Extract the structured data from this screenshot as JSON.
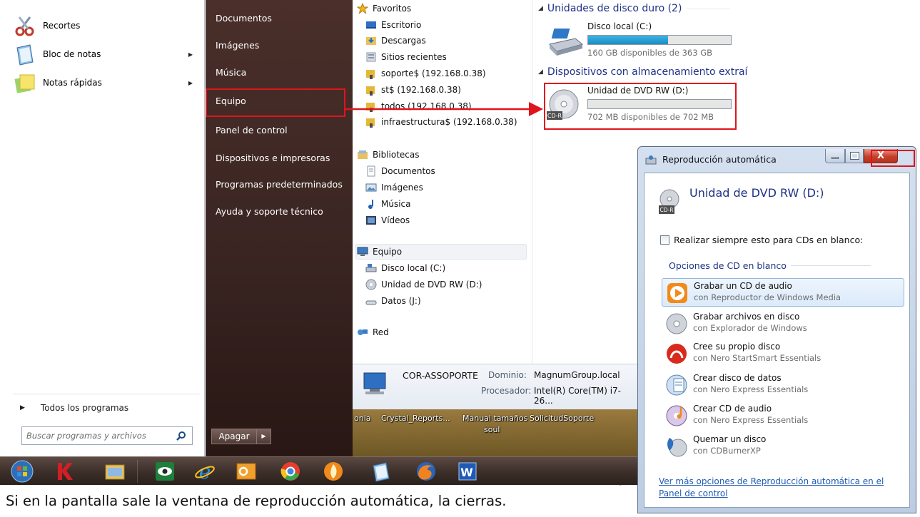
{
  "start_menu": {
    "programs": [
      {
        "label": "Recortes",
        "icon": "scissors-icon",
        "submenu": false
      },
      {
        "label": "Bloc de notas",
        "icon": "notepad-icon",
        "submenu": true
      },
      {
        "label": "Notas rápidas",
        "icon": "sticky-notes-icon",
        "submenu": true
      }
    ],
    "all_programs": "Todos los programas",
    "search_placeholder": "Buscar programas y archivos",
    "places": [
      "Documentos",
      "Imágenes",
      "Música",
      "Equipo",
      "Panel de control",
      "Dispositivos e impresoras",
      "Programas predeterminados",
      "Ayuda y soporte técnico"
    ],
    "shutdown_label": "Apagar"
  },
  "explorer": {
    "nav": {
      "favorites": "Favoritos",
      "favorite_items": [
        "Escritorio",
        "Descargas",
        "Sitios recientes",
        "soporte$ (192.168.0.38)",
        "st$ (192.168.0.38)",
        "todos (192.168.0.38)",
        "infraestructura$ (192.168.0.38)"
      ],
      "libraries": "Bibliotecas",
      "library_items": [
        "Documentos",
        "Imágenes",
        "Música",
        "Vídeos"
      ],
      "computer": "Equipo",
      "computer_items": [
        "Disco local (C:)",
        "Unidad de DVD RW (D:)",
        "Datos (J:)"
      ],
      "network": "Red"
    },
    "groups": {
      "hard_disks": "Unidades de disco duro (2)",
      "removable": "Dispositivos con almacenamiento extraí"
    },
    "drives": [
      {
        "name": "Disco local (C:)",
        "free": "160 GB disponibles de 363 GB",
        "used_fraction": 0.56
      },
      {
        "name": "Unidad de DVD RW (D:)",
        "free": "702 MB disponibles de 702 MB",
        "used_fraction": 0.0
      }
    ],
    "details": {
      "computer_name": "COR-ASSOPORTE",
      "domain_label": "Dominio:",
      "domain_value": "MagnumGroup.local",
      "cpu_label": "Procesador:",
      "cpu_value": "Intel(R) Core(TM) i7-26..."
    }
  },
  "desktop_labels": [
    "onia",
    "Crystal_Reports...",
    "Manual tamaños",
    "SolicitudSoporte",
    "soul"
  ],
  "taskbar": {
    "icons": [
      "start-orb-icon",
      "kaspersky-icon",
      "file-explorer-icon",
      "eye-app-icon",
      "internet-explorer-icon",
      "outlook-icon",
      "chrome-icon",
      "app-flame-icon",
      "notepad-icon",
      "firefox-icon",
      "word-icon"
    ]
  },
  "autoplay": {
    "title": "Reproducción automática",
    "device": "Unidad de DVD RW (D:)",
    "always_do": "Realizar siempre esto para CDs en blanco:",
    "options_header": "Opciones de CD en blanco",
    "options": [
      {
        "label": "Grabar un CD de audio",
        "sub": "con Reproductor de Windows Media",
        "icon": "media-player-icon"
      },
      {
        "label": "Grabar archivos en disco",
        "sub": "con Explorador de Windows",
        "icon": "disc-icon"
      },
      {
        "label": "Cree su propio disco",
        "sub": "con Nero StartSmart Essentials",
        "icon": "nero-icon"
      },
      {
        "label": "Crear disco de datos",
        "sub": "con Nero Express Essentials",
        "icon": "data-disc-icon"
      },
      {
        "label": "Crear CD de audio",
        "sub": "con Nero Express Essentials",
        "icon": "audio-cd-icon"
      },
      {
        "label": "Quemar un disco",
        "sub": "con CDBurnerXP",
        "icon": "cdburner-icon"
      }
    ],
    "more_link": "Ver más opciones de Reproducción automática en el Panel de control",
    "close_glyph": "X"
  },
  "caption": "Si en la pantalla sale la ventana de reproducción automática, la cierras.",
  "colors": {
    "highlight": "#e0141c",
    "link": "#1f5bb5",
    "heading": "#1e3287"
  }
}
